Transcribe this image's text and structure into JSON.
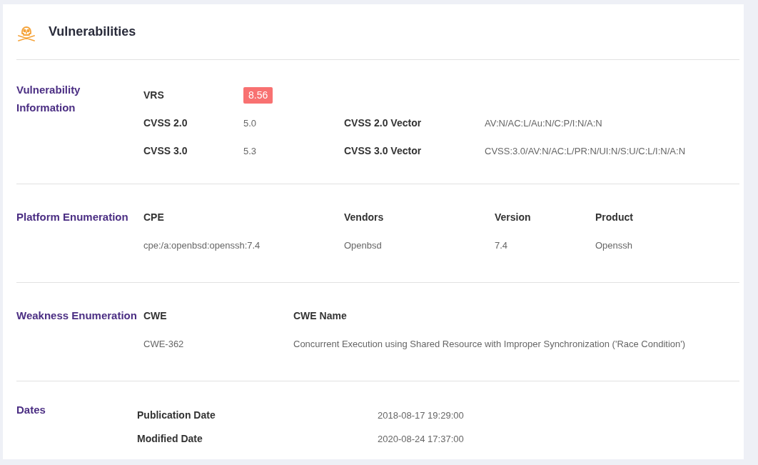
{
  "title": "Vulnerabilities",
  "sections": [
    {
      "kind": "info",
      "label": "Vulnerability Information",
      "vrs": {
        "label": "VRS",
        "value": "8.56"
      },
      "rows": [
        {
          "label": "CVSS 2.0",
          "value": "5.0",
          "vector_label": "CVSS 2.0 Vector",
          "vector": "AV:N/AC:L/Au:N/C:P/I:N/A:N"
        },
        {
          "label": "CVSS 3.0",
          "value": "5.3",
          "vector_label": "CVSS 3.0 Vector",
          "vector": "CVSS:3.0/AV:N/AC:L/PR:N/UI:N/S:U/C:L/I:N/A:N"
        }
      ]
    },
    {
      "kind": "table",
      "label": "Platform Enumeration",
      "columns": [
        "CPE",
        "Vendors",
        "Version",
        "Product"
      ],
      "rows": [
        [
          "cpe:/a:openbsd:openssh:7.4",
          "Openbsd",
          "7.4",
          "Openssh"
        ]
      ]
    },
    {
      "kind": "table",
      "label": "Weakness Enumeration",
      "columns": [
        "CWE",
        "CWE Name"
      ],
      "rows": [
        [
          "CWE-362",
          "Concurrent Execution using Shared Resource with Improper Synchronization ('Race Condition')"
        ]
      ]
    },
    {
      "kind": "dates",
      "label": "Dates",
      "rows": [
        {
          "label": "Publication Date",
          "value": "2018-08-17 19:29:00"
        },
        {
          "label": "Modified Date",
          "value": "2020-08-24 17:37:00"
        }
      ]
    }
  ]
}
